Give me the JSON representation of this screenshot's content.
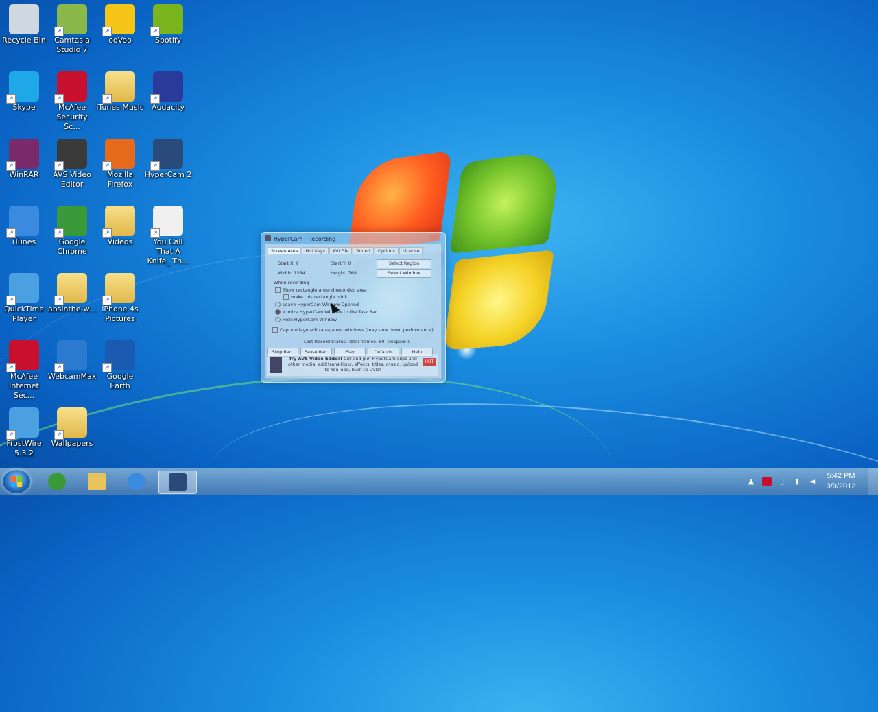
{
  "desktop": {
    "icons": [
      {
        "label": "Recycle Bin",
        "icon": "recycle-bin-icon",
        "color": "#cfd8e0"
      },
      {
        "label": "Camtasia Studio 7",
        "icon": "camtasia-icon",
        "color": "#8ab84a"
      },
      {
        "label": "ooVoo",
        "icon": "oovoo-icon",
        "color": "#f5c518"
      },
      {
        "label": "Spotify",
        "icon": "spotify-icon",
        "color": "#7ab51d"
      },
      {
        "label": "Skype",
        "icon": "skype-icon",
        "color": "#1ea8e8"
      },
      {
        "label": "McAfee Security Sc...",
        "icon": "mcafee-icon",
        "color": "#c8102e"
      },
      {
        "label": "iTunes Music",
        "icon": "folder-icon",
        "color": "#e8c25a"
      },
      {
        "label": "Audacity",
        "icon": "audacity-icon",
        "color": "#2a3a9a"
      },
      {
        "label": "WinRAR",
        "icon": "winrar-icon",
        "color": "#7a2a6a"
      },
      {
        "label": "AVS Video Editor",
        "icon": "avs-icon",
        "color": "#3a3a3a"
      },
      {
        "label": "Mozilla Firefox",
        "icon": "firefox-icon",
        "color": "#e66a1a"
      },
      {
        "label": "HyperCam 2",
        "icon": "hypercam-icon",
        "color": "#2a4a7a"
      },
      {
        "label": "iTunes",
        "icon": "itunes-icon",
        "color": "#3a8ae0"
      },
      {
        "label": "Google Chrome",
        "icon": "chrome-icon",
        "color": "#3a9a3a"
      },
      {
        "label": "Videos",
        "icon": "folder-icon",
        "color": "#e8c25a"
      },
      {
        "label": "You Call That A Knife_ Th...",
        "icon": "mp3-file-icon",
        "color": "#f0f0f0"
      },
      {
        "label": "QuickTime Player",
        "icon": "quicktime-icon",
        "color": "#4aa0e0"
      },
      {
        "label": "absinthe-w...",
        "icon": "folder-icon",
        "color": "#e8c25a"
      },
      {
        "label": "iPhone 4s Pictures",
        "icon": "folder-icon",
        "color": "#e8c25a"
      },
      {
        "label": "",
        "icon": "empty",
        "color": ""
      },
      {
        "label": "McAfee Internet Sec...",
        "icon": "mcafee-shield-icon",
        "color": "#c8102e"
      },
      {
        "label": "WebcamMax",
        "icon": "webcammax-icon",
        "color": "#2a7ad0"
      },
      {
        "label": "Google Earth",
        "icon": "google-earth-icon",
        "color": "#1a5ab0"
      },
      {
        "label": "",
        "icon": "empty",
        "color": ""
      },
      {
        "label": "FrostWire 5.3.2",
        "icon": "frostwire-icon",
        "color": "#4aa0e0"
      },
      {
        "label": "Wallpapers",
        "icon": "folder-icon",
        "color": "#e8c25a"
      }
    ]
  },
  "hypercam": {
    "title": "HyperCam - Recording",
    "tabs": [
      "Screen Area",
      "Hot Keys",
      "AVI File",
      "Sound",
      "Options",
      "License"
    ],
    "start_x_label": "Start X:",
    "start_x": "0",
    "start_y_label": "Start Y:",
    "start_y": "0",
    "width_label": "Width:",
    "width": "1364",
    "height_label": "Height:",
    "height": "768",
    "select_region": "Select Region",
    "select_window": "Select Window",
    "when_recording": "When recording",
    "show_rect": "Show rectangle around recorded area",
    "blink": "make this rectangle blink",
    "leave_open": "Leave HyperCam Window Opened",
    "iconize": "Iconize HyperCam Window to the Task Bar",
    "hide": "Hide HyperCam Window",
    "capture_layered": "Capture layered/transparent windows (may slow down performance)",
    "status": "Last Record Status: Total frames: 80, skipped: 0",
    "buttons": [
      "Stop Rec.",
      "Pause Rec.",
      "Play",
      "Defaults",
      "Help"
    ],
    "promo_title": "Try AVS Video Editor!",
    "promo_text": "Cut and join HyperCam clips and other media, add transitions, effects, titles, music. Upload to YouTube, burn to DVD!",
    "hot": "HOT"
  },
  "taskbar": {
    "pinned": [
      {
        "name": "chrome-icon",
        "color": "#3a9a3a"
      },
      {
        "name": "explorer-icon",
        "color": "#e8c25a"
      },
      {
        "name": "itunes-icon",
        "color": "#3a8ae0"
      },
      {
        "name": "hypercam-icon",
        "color": "#2a4a7a"
      }
    ],
    "time": "5:42 PM",
    "date": "3/9/2012"
  }
}
